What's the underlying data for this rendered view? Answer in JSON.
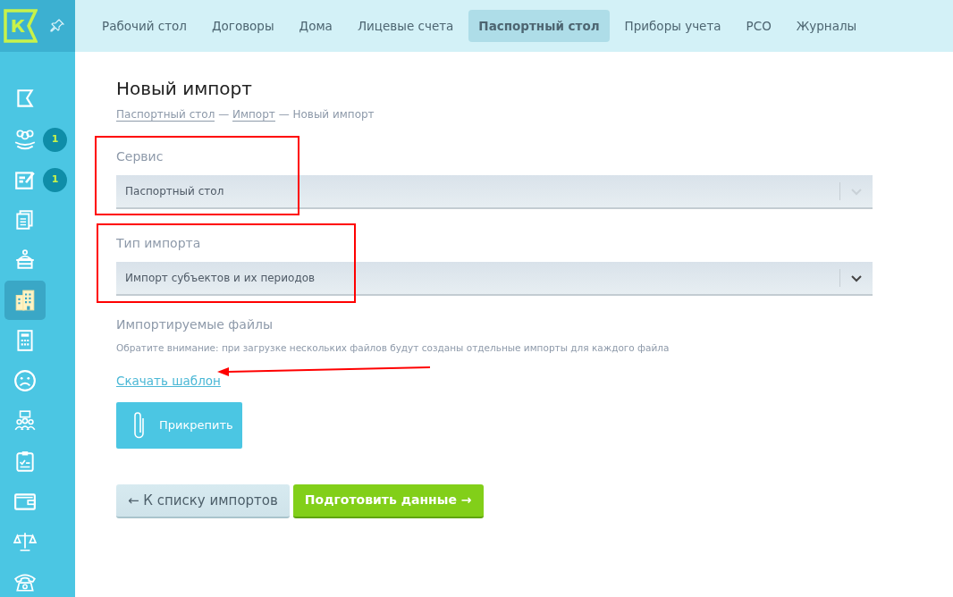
{
  "sidebar": {
    "items": [
      {
        "selected": false
      },
      {
        "selected": false,
        "badge": "1"
      },
      {
        "selected": false,
        "badge": "1"
      },
      {
        "selected": false
      },
      {
        "selected": false
      },
      {
        "selected": true
      },
      {
        "selected": false
      },
      {
        "selected": false
      },
      {
        "selected": false
      },
      {
        "selected": false
      },
      {
        "selected": false
      },
      {
        "selected": false
      },
      {
        "selected": false
      }
    ]
  },
  "logo": {
    "letter": "К"
  },
  "tabs": [
    {
      "label": "Рабочий стол",
      "selected": false
    },
    {
      "label": "Договоры",
      "selected": false
    },
    {
      "label": "Дома",
      "selected": false
    },
    {
      "label": "Лицевые счета",
      "selected": false
    },
    {
      "label": "Паспортный стол",
      "selected": true
    },
    {
      "label": "Приборы учета",
      "selected": false
    },
    {
      "label": "РСО",
      "selected": false
    },
    {
      "label": "Журналы",
      "selected": false
    }
  ],
  "page": {
    "title": "Новый импорт",
    "breadcrumbs": [
      {
        "label": "Паспортный стол",
        "link": true
      },
      {
        "label": "—",
        "link": false
      },
      {
        "label": "Импорт",
        "link": true
      },
      {
        "label": "— Новый импорт",
        "link": false
      }
    ]
  },
  "fields": [
    {
      "label": "Сервис",
      "value": "Паспортный стол",
      "disabled": true
    },
    {
      "label": "Тип импорта",
      "value": "Импорт субъектов и их периодов",
      "disabled": false
    }
  ],
  "files": {
    "label": "Импортируемые файлы",
    "note": "Обратите внимание: при загрузке нескольких файлов будут созданы отдельные импорты для каждого файла",
    "template_link": "Скачать шаблон",
    "attach_button": "Прикрепить"
  },
  "buttons": [
    {
      "label": "← К списку импортов",
      "kind": "secondary"
    },
    {
      "label": "Подготовить данные →",
      "kind": "primary"
    }
  ]
}
